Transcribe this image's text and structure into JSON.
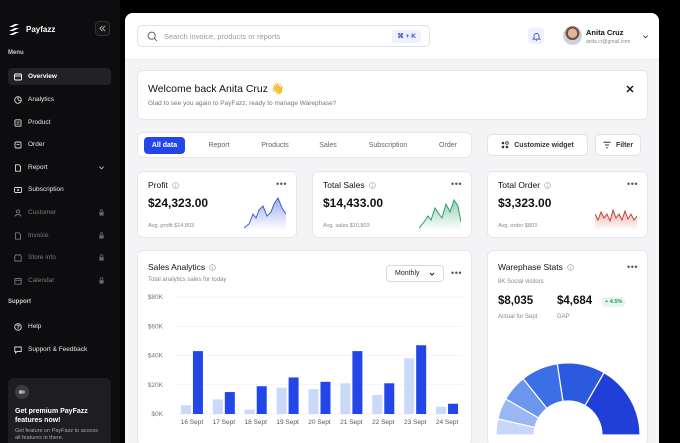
{
  "brand": {
    "name": "Payfazz"
  },
  "sidebar": {
    "menu_title": "Menu",
    "items": [
      {
        "label": "Overview"
      },
      {
        "label": "Analytics"
      },
      {
        "label": "Product"
      },
      {
        "label": "Order"
      },
      {
        "label": "Report"
      },
      {
        "label": "Subscription"
      },
      {
        "label": "Customer"
      },
      {
        "label": "Invoice"
      },
      {
        "label": "Store info"
      },
      {
        "label": "Calendar"
      }
    ],
    "support_title": "Support",
    "support_items": [
      {
        "label": "Help"
      },
      {
        "label": "Support & Feedback"
      }
    ],
    "promo": {
      "title": "Get premium PayFazz features now!",
      "text": "Get feature on PayFazz to access all features in there."
    }
  },
  "topbar": {
    "search_placeholder": "Search invoice, products or reports",
    "shortcut": "⌘ + K",
    "user_name": "Anita Cruz",
    "user_email": "anita.cr@gmail.com"
  },
  "welcome": {
    "title": "Welcome back Anita Cruz 👋",
    "subtitle": "Glad to see you again to PayFazz, ready to manage Warephase?"
  },
  "tabs": [
    "All data",
    "Report",
    "Products",
    "Sales",
    "Subscription",
    "Order"
  ],
  "actions": {
    "customize": "Customize widget",
    "filter": "Filter"
  },
  "stats": [
    {
      "title": "Profit",
      "value": "$24,323.00",
      "foot": "Avg. profit $14,803"
    },
    {
      "title": "Total Sales",
      "value": "$14,433.00",
      "foot": "Avg. sales $10,803"
    },
    {
      "title": "Total Order",
      "value": "$3,323.00",
      "foot": "Avg. order $803"
    }
  ],
  "sales": {
    "title": "Sales Analytics",
    "subtitle": "Total analytics sales for today",
    "period": "Monthly"
  },
  "warephase": {
    "title": "Warephase Stats",
    "subtitle": "8K Social visitors",
    "actual_value": "$8,035",
    "actual_label": "Actual for Sept",
    "gap_value": "$4,684",
    "gap_label": "GAP",
    "badge": "+ 4.5%"
  },
  "colors": {
    "accent": "#2346e8",
    "accent_light": "#c9d9f8",
    "positive": "#1f9d55",
    "negative": "#c0392b"
  },
  "chart_data": [
    {
      "type": "bar",
      "title": "Sales Analytics",
      "categories": [
        "16 Sept",
        "17 Sept",
        "18 Sept",
        "19 Sept",
        "20 Sept",
        "21 Sept",
        "22 Sept",
        "23 Sept",
        "24 Sept"
      ],
      "series": [
        {
          "values": [
            6,
            10,
            3,
            18,
            17,
            21,
            13,
            38,
            5
          ]
        },
        {
          "values": [
            43,
            15,
            19,
            25,
            22,
            43,
            21,
            47,
            7
          ]
        }
      ],
      "yticks": [
        "$0K",
        "$20K",
        "$40K",
        "$60K",
        "$80K"
      ],
      "ylim": [
        0,
        80
      ]
    },
    {
      "type": "pie",
      "title": "Warephase Stats",
      "segments": [
        {
          "color": "#1f3fd6",
          "value": 28
        },
        {
          "color": "#2b59e0",
          "value": 18
        },
        {
          "color": "#3c6ee8",
          "value": 14
        },
        {
          "color": "#6c95ee",
          "value": 10
        },
        {
          "color": "#9ab7f4",
          "value": 8
        },
        {
          "color": "#c6d7f9",
          "value": 6
        }
      ]
    }
  ]
}
